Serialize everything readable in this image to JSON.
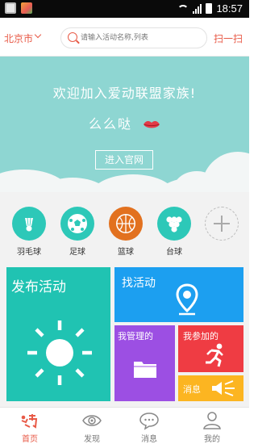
{
  "status_bar": {
    "time": "18:57"
  },
  "header": {
    "city": "北京市",
    "search_placeholder": "请输入活动名称,列表",
    "scan_label": "扫一扫"
  },
  "banner": {
    "welcome": "欢迎加入爱动联盟家族!",
    "kiss_text": "么么哒",
    "enter_button": "进入官网"
  },
  "categories": [
    {
      "label": "羽毛球",
      "color": "#2dc8b8"
    },
    {
      "label": "足球",
      "color": "#2dc8b8"
    },
    {
      "label": "篮球",
      "color": "#e2711f"
    },
    {
      "label": "台球",
      "color": "#2dc8b8"
    }
  ],
  "tiles": {
    "publish": "发布活动",
    "find": "找活动",
    "manage": "我管理的",
    "join": "我参加的",
    "message": "消息"
  },
  "bottom_nav": [
    {
      "label": "首页",
      "active": true
    },
    {
      "label": "发现",
      "active": false
    },
    {
      "label": "消息",
      "active": false
    },
    {
      "label": "我的",
      "active": false
    }
  ],
  "colors": {
    "accent": "#e85a47",
    "banner": "#8ed6d2",
    "publish": "#20c3b2",
    "find": "#1c9ff0",
    "manage": "#9c4fe3",
    "join": "#ef3c43",
    "message": "#fcb521"
  }
}
